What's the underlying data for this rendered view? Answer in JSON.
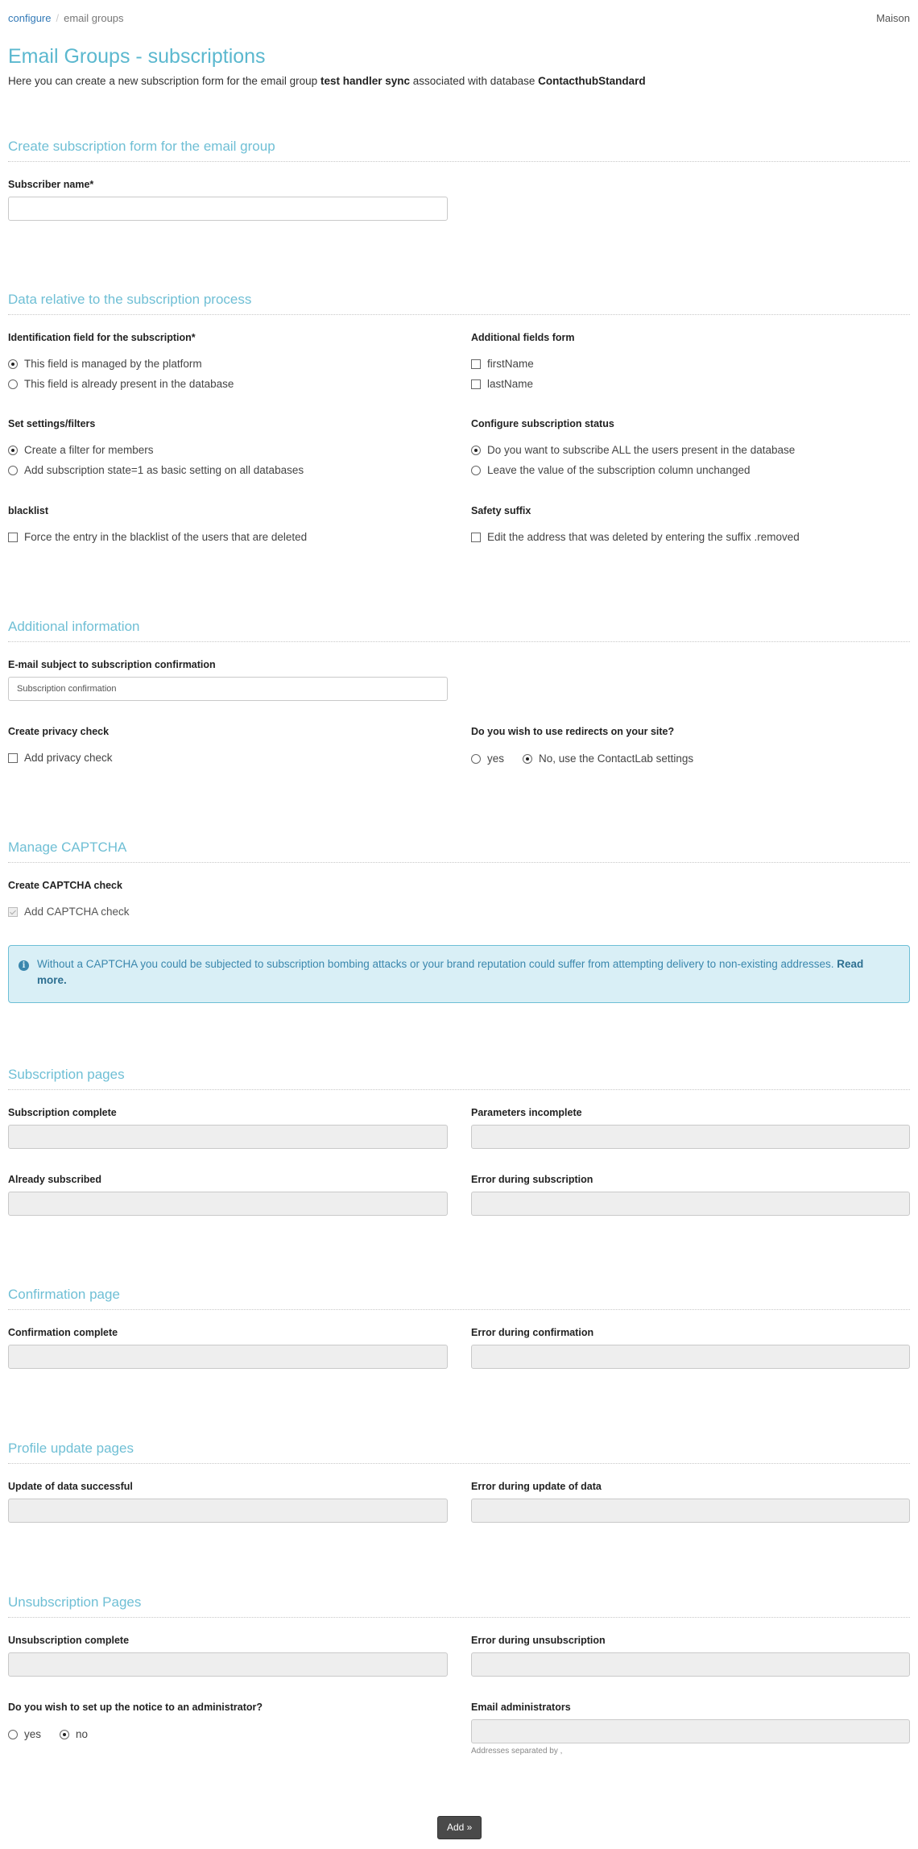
{
  "breadcrumb": {
    "link": "configure",
    "separator": "/",
    "current": "email groups"
  },
  "user": "Maison",
  "page_title": "Email Groups - subscriptions",
  "intro": {
    "prefix": "Here you can create a new subscription form for the email group ",
    "group": "test handler sync",
    "middle": " associated with database ",
    "database": "ContacthubStandard"
  },
  "sections": {
    "create": {
      "title": "Create subscription form for the email group",
      "subscriber_name_label": "Subscriber name*",
      "subscriber_name_value": ""
    },
    "process": {
      "title": "Data relative to the subscription process",
      "identification": {
        "label": "Identification field for the subscription*",
        "options": [
          {
            "label": "This field is managed by the platform",
            "selected": true
          },
          {
            "label": "This field is already present in the database",
            "selected": false
          }
        ]
      },
      "additional_fields": {
        "label": "Additional fields form",
        "options": [
          {
            "label": "firstName",
            "checked": false
          },
          {
            "label": "lastName",
            "checked": false
          }
        ]
      },
      "settings": {
        "label": "Set settings/filters",
        "options": [
          {
            "label": "Create a filter for members",
            "selected": true
          },
          {
            "label": "Add subscription state=1 as basic setting on all databases",
            "selected": false
          }
        ]
      },
      "status": {
        "label": "Configure subscription status",
        "options": [
          {
            "label": "Do you want to subscribe ALL the users present in the database",
            "selected": true
          },
          {
            "label": "Leave the value of the subscription column unchanged",
            "selected": false
          }
        ]
      },
      "blacklist": {
        "label": "blacklist",
        "option": {
          "label": "Force the entry in the blacklist of the users that are deleted",
          "checked": false
        }
      },
      "safety": {
        "label": "Safety suffix",
        "option": {
          "label": "Edit the address that was deleted by entering the suffix .removed",
          "checked": false
        }
      }
    },
    "additional": {
      "title": "Additional information",
      "subject_label": "E-mail subject to subscription confirmation",
      "subject_value": "Subscription confirmation",
      "privacy_label": "Create privacy check",
      "privacy_option": {
        "label": "Add privacy check",
        "checked": false
      },
      "redirects_label": "Do you wish to use redirects on your site?",
      "redirects_options": [
        {
          "label": "yes",
          "selected": false
        },
        {
          "label": "No, use the ContactLab settings",
          "selected": true
        }
      ]
    },
    "captcha": {
      "title": "Manage CAPTCHA",
      "label": "Create CAPTCHA check",
      "option": {
        "label": "Add CAPTCHA check",
        "checked": true,
        "disabled": true
      },
      "alert": {
        "icon": "info-icon",
        "text": "Without a CAPTCHA you could be subjected to subscription bombing attacks or your brand reputation could suffer from attempting delivery to non-existing addresses. ",
        "link": "Read more."
      }
    },
    "subscription_pages": {
      "title": "Subscription pages",
      "fields": [
        {
          "label": "Subscription complete",
          "value": ""
        },
        {
          "label": "Parameters incomplete",
          "value": ""
        },
        {
          "label": "Already subscribed",
          "value": ""
        },
        {
          "label": "Error during subscription",
          "value": ""
        }
      ]
    },
    "confirmation_page": {
      "title": "Confirmation page",
      "fields": [
        {
          "label": "Confirmation complete",
          "value": ""
        },
        {
          "label": "Error during confirmation",
          "value": ""
        }
      ]
    },
    "profile_pages": {
      "title": "Profile update pages",
      "fields": [
        {
          "label": "Update of data successful",
          "value": ""
        },
        {
          "label": "Error during update of data",
          "value": ""
        }
      ]
    },
    "unsubscription_pages": {
      "title": "Unsubscription Pages",
      "fields": [
        {
          "label": "Unsubscription complete",
          "value": ""
        },
        {
          "label": "Error during unsubscription",
          "value": ""
        }
      ],
      "notice_label": "Do you wish to set up the notice to an administrator?",
      "notice_options": [
        {
          "label": "yes",
          "selected": false
        },
        {
          "label": "no",
          "selected": true
        }
      ],
      "admins_label": "Email administrators",
      "admins_value": "",
      "admins_help": "Addresses separated by ,"
    }
  },
  "submit_label": "Add »"
}
